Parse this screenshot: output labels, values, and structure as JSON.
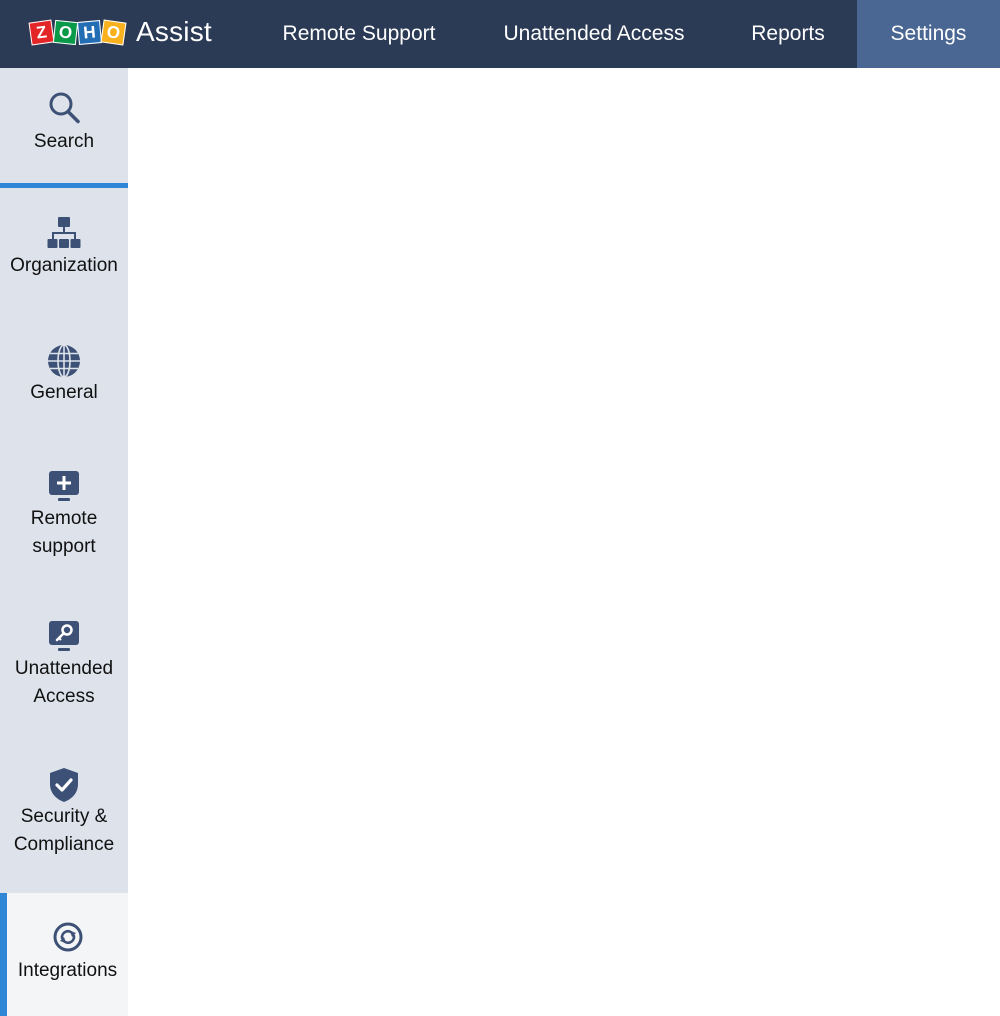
{
  "brand": {
    "logo_letters": [
      "Z",
      "O",
      "H",
      "O"
    ],
    "product": "Assist",
    "colors": {
      "z": "#e42527",
      "o1": "#089949",
      "h": "#226db4",
      "o2": "#f9b21d"
    }
  },
  "topnav": {
    "items": [
      {
        "label": "Remote Support",
        "active": false
      },
      {
        "label": "Unattended Access",
        "active": false
      },
      {
        "label": "Reports",
        "active": false
      },
      {
        "label": "Settings",
        "active": true
      }
    ]
  },
  "sidebar": {
    "items": [
      {
        "label": "Search",
        "icon": "search-icon"
      },
      {
        "label": "Organization",
        "icon": "org-chart-icon"
      },
      {
        "label": "General",
        "icon": "globe-icon"
      },
      {
        "label": "Remote",
        "label2": "support",
        "icon": "monitor-plus-icon"
      },
      {
        "label": "Unattended",
        "label2": "Access",
        "icon": "monitor-key-icon"
      },
      {
        "label": "Security &",
        "label2": "Compliance",
        "icon": "shield-check-icon"
      },
      {
        "label": "Integrations",
        "icon": "sync-icon",
        "active": true
      }
    ]
  },
  "colors": {
    "topbar": "#2b3a55",
    "topbar_active": "#4a6793",
    "sidebar": "#dde2eb",
    "sidebar_active": "#f4f5f7",
    "accent": "#2f86d6",
    "icon": "#3d5176"
  }
}
